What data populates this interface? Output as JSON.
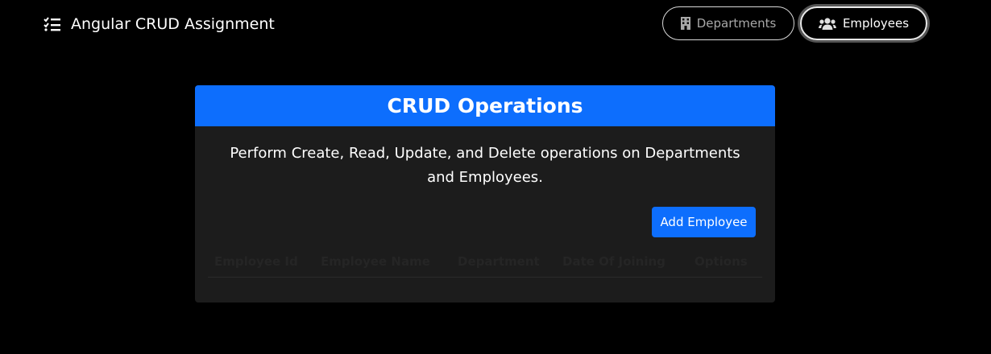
{
  "navbar": {
    "brand_label": "Angular CRUD Assignment",
    "brand_icon": "list-check-icon",
    "links": [
      {
        "label": "Departments",
        "icon": "building-icon"
      },
      {
        "label": "Employees",
        "icon": "users-icon",
        "active": true
      }
    ]
  },
  "card": {
    "title": "CRUD Operations",
    "description": "Perform Create, Read, Update, and Delete operations on Departments and Employees.",
    "add_button_label": "Add Employee",
    "table": {
      "headers": [
        "Employee Id",
        "Employee Name",
        "Department",
        "Date Of Joining",
        "Options"
      ],
      "rows": []
    }
  },
  "colors": {
    "background": "#000000",
    "primary": "#0d6efd",
    "card": "#1c1c1c"
  }
}
